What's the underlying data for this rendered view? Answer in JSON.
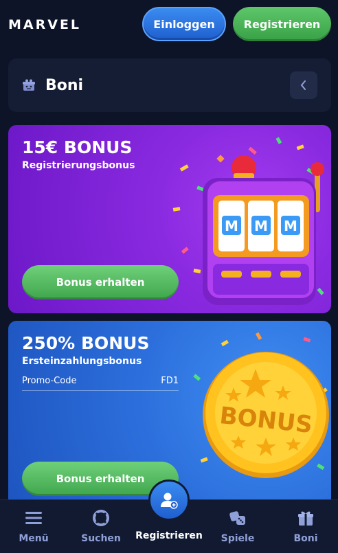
{
  "header": {
    "logo": "MARVEL",
    "login_label": "Einloggen",
    "register_label": "Registrieren"
  },
  "section": {
    "title": "Boni",
    "icon": "gift-box-icon",
    "back_icon": "chevron-left-icon"
  },
  "bonuses": [
    {
      "title": "15€ BONUS",
      "subtitle": "Registrierungsbonus",
      "button_label": "Bonus erhalten",
      "art": "slot-machine-illustration",
      "reel_letters": [
        "M",
        "M",
        "M"
      ],
      "background": "#8a2ae0"
    },
    {
      "title": "250% BONUS",
      "subtitle": "Ersteinzahlungsbonus",
      "promo_label": "Promo-Code",
      "promo_code": "FD1",
      "button_label": "Bonus erhalten",
      "art": "gold-bonus-coin-illustration",
      "coin_text": "BONUS",
      "background": "#2c6fdc"
    }
  ],
  "bottom_nav": {
    "items": [
      {
        "label": "Menü",
        "icon": "hamburger-menu-icon"
      },
      {
        "label": "Suchen",
        "icon": "lifebuoy-icon"
      },
      {
        "label": "Registrieren",
        "icon": "add-user-icon",
        "active": true
      },
      {
        "label": "Spiele",
        "icon": "dice-icon"
      },
      {
        "label": "Boni",
        "icon": "gift-icon"
      }
    ]
  },
  "colors": {
    "background": "#0d1428",
    "primary_blue": "#2a78e4",
    "primary_green": "#4cb85a",
    "nav_inactive": "#8fa0d8"
  }
}
